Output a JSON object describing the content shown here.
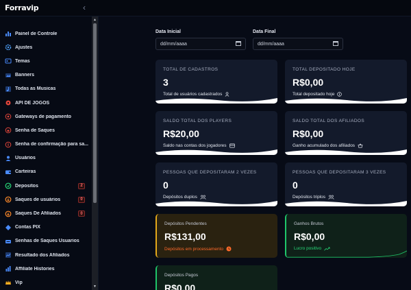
{
  "app": {
    "brand": "Forravip",
    "collapse_icon": "chevron-left-icon"
  },
  "sidebar": {
    "items": [
      {
        "label": "Painel de Controle",
        "icon": "bar-chart-icon",
        "badge": null
      },
      {
        "label": "Ajustes",
        "icon": "gear-icon",
        "badge": null
      },
      {
        "label": "Temas",
        "icon": "palette-icon",
        "badge": null
      },
      {
        "label": "Banners",
        "icon": "image-icon",
        "badge": null
      },
      {
        "label": "Todas as Musicas",
        "icon": "music-icon",
        "badge": null
      },
      {
        "label": "API DE JOGOS",
        "icon": "gamepad-icon",
        "badge": null
      },
      {
        "label": "Gateways de pagamento",
        "icon": "credit-card-icon",
        "badge": null
      },
      {
        "label": "Senha de Saques",
        "icon": "lock-icon",
        "badge": null
      },
      {
        "label": "Senha de confirmação para sa...",
        "icon": "key-icon",
        "badge": null
      },
      {
        "label": "Usuários",
        "icon": "user-icon",
        "badge": null
      },
      {
        "label": "Carteiras",
        "icon": "wallet-icon",
        "badge": null
      },
      {
        "label": "Depositos",
        "icon": "deposit-icon",
        "badge": "2"
      },
      {
        "label": "Saques de usuários",
        "icon": "withdraw-icon",
        "badge": "0"
      },
      {
        "label": "Saques De Afiliados",
        "icon": "affiliate-withdraw-icon",
        "badge": "0"
      },
      {
        "label": "Contas PIX",
        "icon": "pix-icon",
        "badge": null
      },
      {
        "label": "Senhas de Saques Usuarios",
        "icon": "passwords-icon",
        "badge": null
      },
      {
        "label": "Resultado dos Afiliados",
        "icon": "chart-icon",
        "badge": null
      },
      {
        "label": "Affiliate Histories",
        "icon": "history-icon",
        "badge": null
      },
      {
        "label": "Vip",
        "icon": "crown-icon",
        "badge": null
      }
    ]
  },
  "filters": {
    "start": {
      "label": "Data Inicial",
      "value": "dd/mm/aaaa"
    },
    "end": {
      "label": "Data Final",
      "value": "dd/mm/aaaa"
    }
  },
  "cards": {
    "total_cadastros": {
      "title": "TOTAL DE CADASTROS",
      "value": "3",
      "sub": "Total de usuários cadastrados",
      "icon": "user-outline-icon"
    },
    "total_depositado": {
      "title": "TOTAL DEPOSITADO HOJE",
      "value": "R$0,00",
      "sub": "Total depositado hoje",
      "icon": "dollar-circle-icon"
    },
    "saldo_players": {
      "title": "SALDO TOTAL DOS PLAYERS",
      "value": "R$20,00",
      "sub": "Saldo nas contas dos jogadores",
      "icon": "card-icon"
    },
    "saldo_afiliados": {
      "title": "SALDO TOTAL DOS AFILIADOS",
      "value": "R$0,00",
      "sub": "Ganho acumulado dos afiliados",
      "icon": "basket-icon"
    },
    "depositos_2x": {
      "title": "PESSOAS QUE DEPOSITARAM 2 VEZES",
      "value": "0",
      "sub": "Depósitos duplos",
      "icon": "group-icon"
    },
    "depositos_3x": {
      "title": "PESSOAS QUE DEPOSITARAM 3 VEZES",
      "value": "0",
      "sub": "Depósitos triplos",
      "icon": "group-icon"
    },
    "pendentes": {
      "title": "Depósitos Pendentes",
      "value": "R$131,00",
      "sub": "Depósitos em processamento",
      "icon": "clock-icon"
    },
    "ganhos": {
      "title": "Ganhos Brutos",
      "value": "R$0,00",
      "sub": "Lucro positivo",
      "icon": "trend-up-icon"
    },
    "pagos": {
      "title": "Depósitos Pagos",
      "value": "R$0,00"
    }
  },
  "colors": {
    "background": "#070b16",
    "card": "#131a2b",
    "accent_orange": "#e5a91a",
    "accent_green": "#1fc66a",
    "badge_red": "#ff6b6b"
  }
}
